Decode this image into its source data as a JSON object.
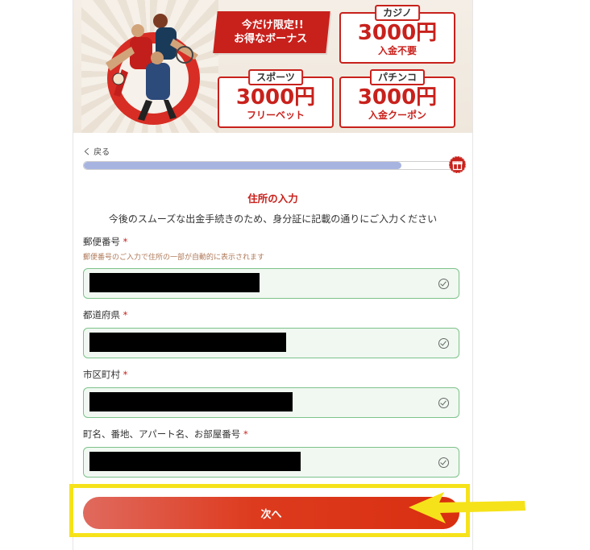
{
  "banner": {
    "promo_line1": "今だけ限定!!",
    "promo_line2": "お得なボーナス",
    "boxes": [
      {
        "tag": "カジノ",
        "amount": "3000円",
        "sub": "入金不要"
      },
      {
        "tag": "スポーツ",
        "amount": "3000円",
        "sub": "フリーベット"
      },
      {
        "tag": "パチンコ",
        "amount": "3000円",
        "sub": "入金クーポン"
      }
    ]
  },
  "nav": {
    "back_label": "く 戻る"
  },
  "progress": {
    "value_percent": 86
  },
  "form": {
    "title": "住所の入力",
    "subtitle": "今後のスムーズな出金手続きのため、身分証に記載の通りにご入力ください",
    "required_mark": "*",
    "postal": {
      "label": "郵便番号",
      "hint": "郵便番号のご入力で住所の一部が自動的に表示されます"
    },
    "prefecture": {
      "label": "都道府県"
    },
    "city": {
      "label": "市区町村"
    },
    "street": {
      "label": "町名、番地、アパート名、お部屋番号"
    },
    "next_label": "次へ"
  },
  "colors": {
    "accent": "#c8211c",
    "field_border": "#7dc28a",
    "field_bg": "#f0f8f1",
    "progress_fill": "#a8b4e0",
    "highlight": "#f6e21a"
  },
  "icons": {
    "gift": "gift-icon",
    "check": "check-circle-icon",
    "back": "chevron-left-icon",
    "annotation_arrow": "arrow-left-icon"
  }
}
